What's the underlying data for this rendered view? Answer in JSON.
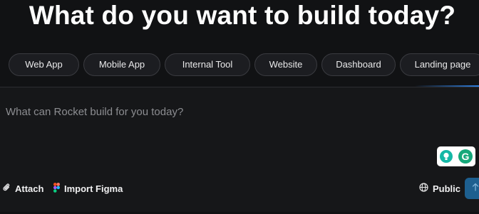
{
  "headline": "What do you want to build today?",
  "chips": [
    "Web App",
    "Mobile App",
    "Internal Tool",
    "Website",
    "Dashboard",
    "Landing page"
  ],
  "prompt": {
    "placeholder": "What can Rocket build for you today?"
  },
  "extension_badges": {
    "grammarly_letter": "G"
  },
  "toolbar": {
    "attach_label": "Attach",
    "import_figma_label": "Import Figma",
    "visibility_label": "Public"
  },
  "icons": [
    "paperclip-icon",
    "figma-icon",
    "globe-icon",
    "arrow-up-icon",
    "lightbulb-icon",
    "grammarly-icon"
  ],
  "colors": {
    "background": "#111214",
    "chip_border": "#3a3b40",
    "send_button": "#1d5f8f",
    "accent_glow": "#2f7fe0"
  }
}
